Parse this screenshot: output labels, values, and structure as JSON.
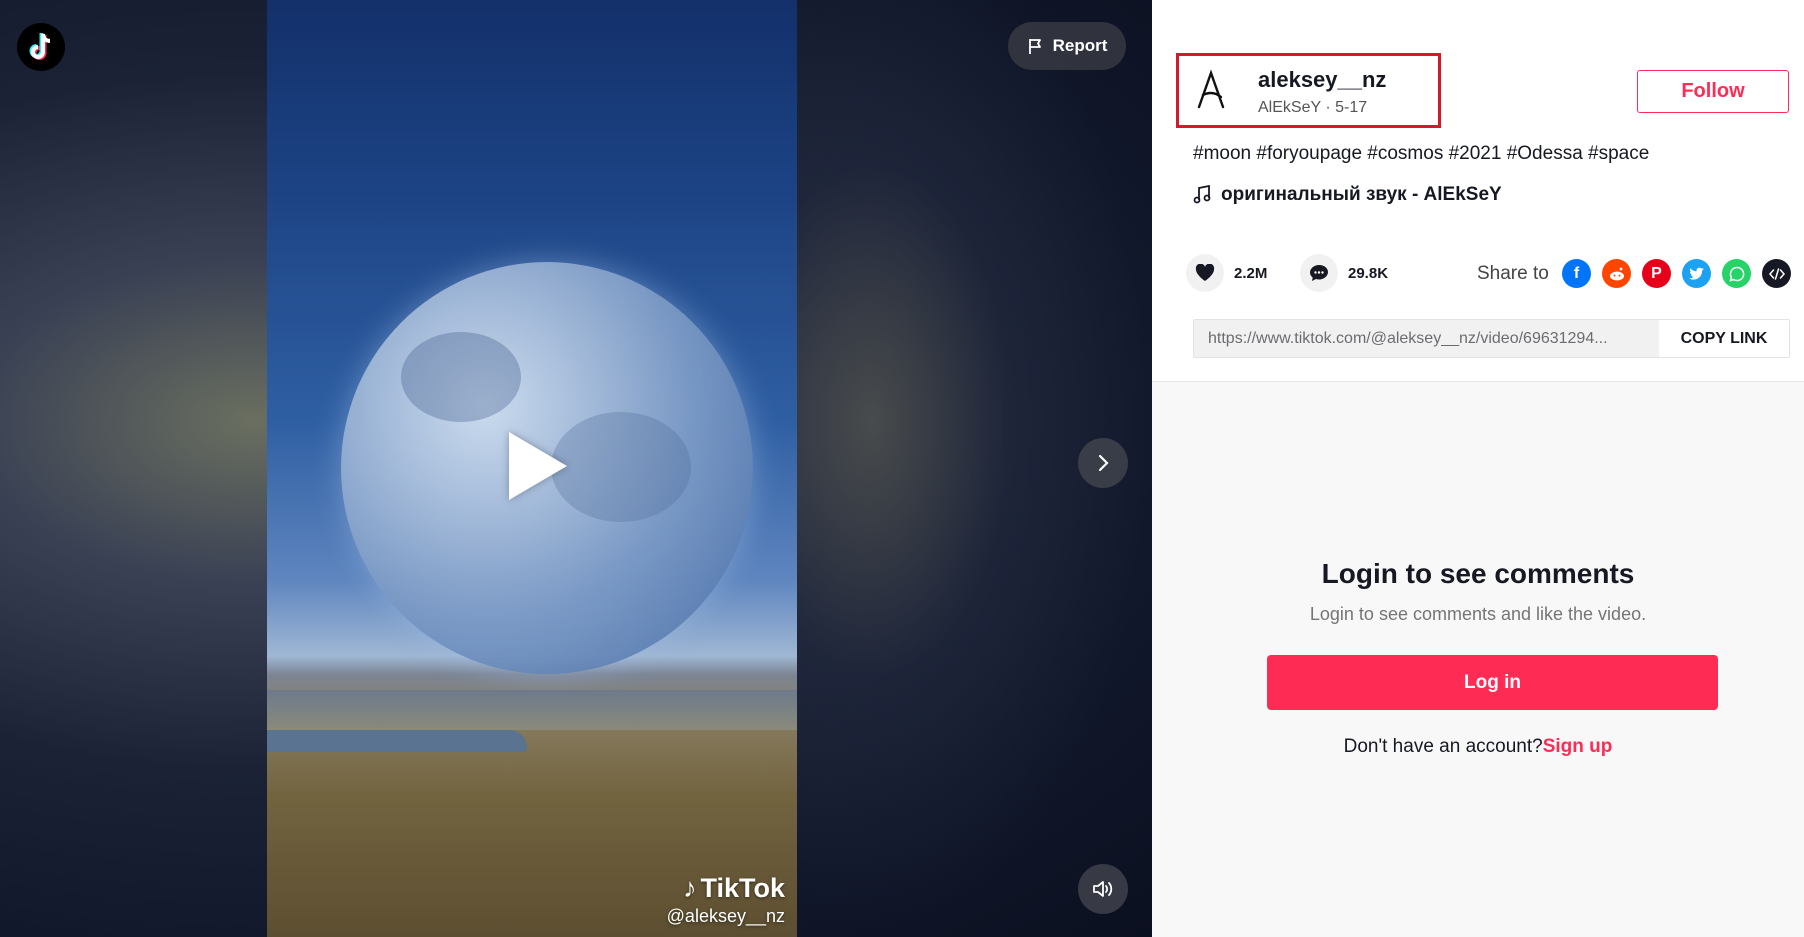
{
  "video": {
    "watermark_brand": "TikTok",
    "watermark_user": "@aleksey__nz",
    "report_label": "Report"
  },
  "author": {
    "username": "aleksey__nz",
    "nickname": "AlEkSeY",
    "date": "5-17",
    "follow_label": "Follow"
  },
  "caption": "#moon #foryoupage #cosmos #2021 #Odessa #space",
  "music": "оригинальный звук - AlEkSeY",
  "stats": {
    "likes": "2.2M",
    "comments": "29.8K"
  },
  "share": {
    "label": "Share to",
    "icons": [
      "facebook-icon",
      "reddit-icon",
      "pinterest-icon",
      "twitter-icon",
      "whatsapp-icon",
      "embed-icon"
    ]
  },
  "link": {
    "url": "https://www.tiktok.com/@aleksey__nz/video/69631294...",
    "copy_label": "COPY LINK"
  },
  "login": {
    "title": "Login to see comments",
    "subtitle": "Login to see comments and like the video.",
    "button": "Log in",
    "no_account": "Don't have an account?",
    "signup": "Sign up"
  },
  "colors": {
    "brand": "#fe2c55",
    "highlight_box": "#d11a2a"
  }
}
